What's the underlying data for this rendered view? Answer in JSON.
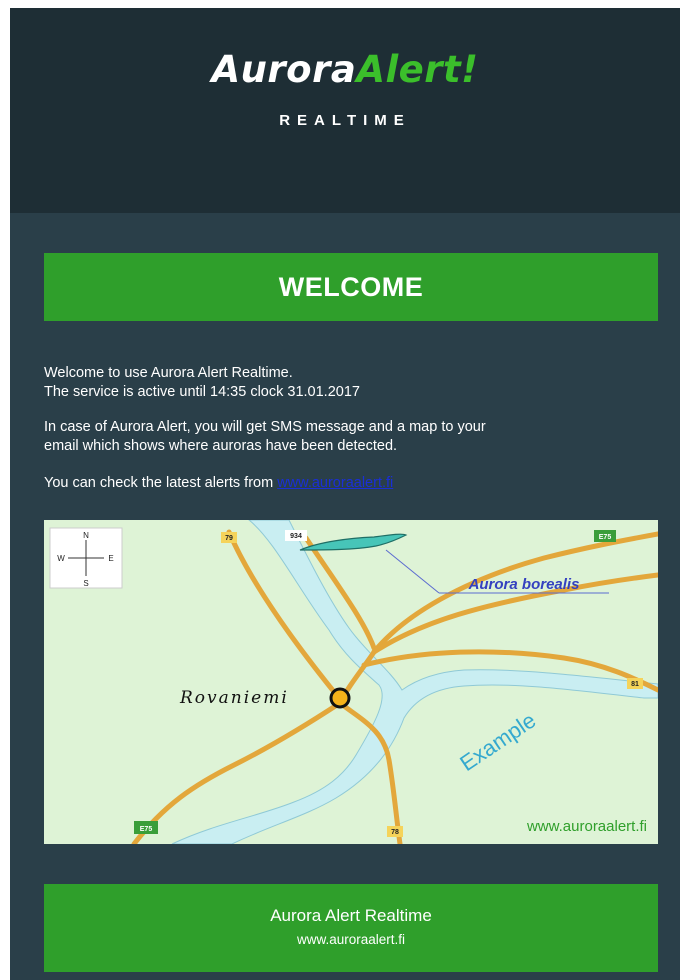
{
  "header": {
    "logo_part1": "Aurora",
    "logo_part2": "Alert!",
    "subtitle": "REALTIME"
  },
  "banner": {
    "title": "WELCOME"
  },
  "body": {
    "line1": "Welcome to use Aurora Alert Realtime.",
    "line2": "The service is active until 14:35 clock 31.01.2017",
    "para2_line1": "In case of Aurora Alert, you will get SMS message and a map to your",
    "para2_line2": "email which shows where auroras have been detected.",
    "para3_text": "You can check the latest alerts from ",
    "para3_link": "www.auroraalert.fi"
  },
  "map": {
    "compass_n": "N",
    "compass_s": "S",
    "compass_w": "W",
    "compass_e": "E",
    "road_79": "79",
    "road_934": "934",
    "road_e75_top": "E75",
    "road_e75_bottom": "E75",
    "road_81": "81",
    "road_78": "78",
    "aurora_label": "Aurora borealis",
    "city": "Rovaniemi",
    "example": "Example",
    "watermark": "www.auroraalert.fi"
  },
  "footer": {
    "line1": "Aurora Alert Realtime",
    "line2": "www.auroraalert.fi"
  },
  "colors": {
    "header_bg": "#1e2e35",
    "body_bg": "#2a3f49",
    "accent_green": "#2f9f2b",
    "logo_green": "#3bbf2b",
    "link_blue": "#1a2fd6",
    "map_bg": "#def3d6",
    "road": "#e6a93a",
    "river": "#c9eef2"
  }
}
